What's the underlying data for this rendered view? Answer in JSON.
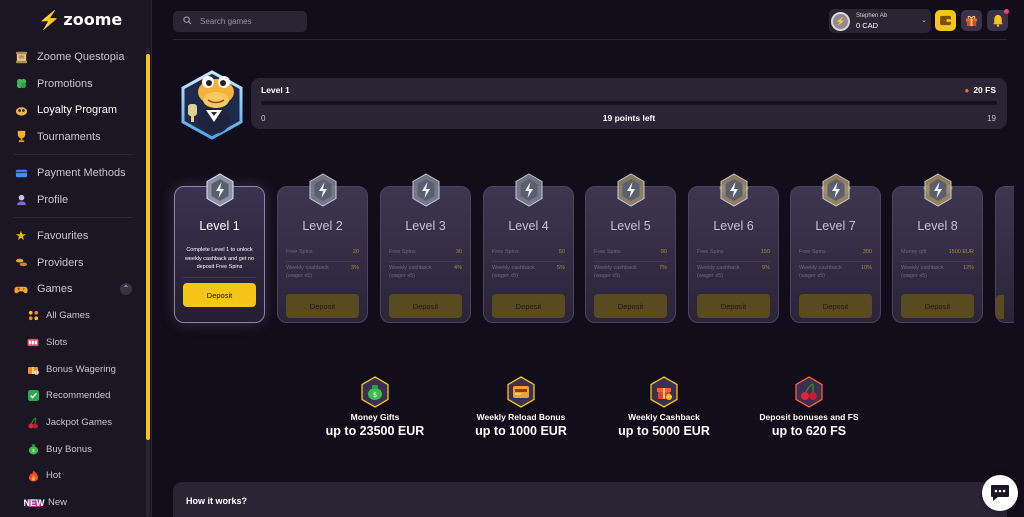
{
  "brand": {
    "name": "zoome"
  },
  "sidebar": {
    "items": [
      {
        "label": "Zoome Questopia",
        "icon": "scroll-icon"
      },
      {
        "label": "Promotions",
        "icon": "clover-icon"
      },
      {
        "label": "Loyalty Program",
        "icon": "loyalty-icon",
        "active": true
      },
      {
        "label": "Tournaments",
        "icon": "trophy-icon"
      },
      {
        "label": "Payment Methods",
        "icon": "card-icon"
      },
      {
        "label": "Profile",
        "icon": "profile-icon"
      },
      {
        "label": "Favourites",
        "icon": "star-icon"
      },
      {
        "label": "Providers",
        "icon": "providers-icon"
      },
      {
        "label": "Games",
        "icon": "gamepad-icon"
      }
    ],
    "games_sub": [
      {
        "label": "All Games",
        "icon": "grid-icon"
      },
      {
        "label": "Slots",
        "icon": "slots-icon"
      },
      {
        "label": "Bonus Wagering",
        "icon": "bonus-icon"
      },
      {
        "label": "Recommended",
        "icon": "check-icon"
      },
      {
        "label": "Jackpot Games",
        "icon": "cherry-icon"
      },
      {
        "label": "Buy Bonus",
        "icon": "money-bag-icon"
      },
      {
        "label": "Hot",
        "icon": "fire-icon"
      },
      {
        "label": "New",
        "icon": "new-badge-icon",
        "badge": "NEW"
      }
    ]
  },
  "search": {
    "placeholder": "Search games"
  },
  "user": {
    "name": "Stephen Ab",
    "balance": "0 CAD"
  },
  "level_progress": {
    "title": "Level 1",
    "reward": "20 FS",
    "min": "0",
    "max": "19",
    "points_left": "19 points left",
    "progress": 0
  },
  "levels": [
    {
      "title": "Level 1",
      "active": true,
      "description": "Complete Level 1 to unlock weekly cashback and get no deposit Free Spins",
      "deposit": "Deposit"
    },
    {
      "title": "Level 2",
      "row1_k": "Free Spins",
      "row1_v": "20",
      "row2_k": "Weekly cashback (wager x5)",
      "row2_v": "3%",
      "deposit": "Deposit"
    },
    {
      "title": "Level 3",
      "row1_k": "Free Spins",
      "row1_v": "30",
      "row2_k": "Weekly cashback (wager x5)",
      "row2_v": "4%",
      "deposit": "Deposit"
    },
    {
      "title": "Level 4",
      "row1_k": "Free Spins",
      "row1_v": "50",
      "row2_k": "Weekly cashback (wager x5)",
      "row2_v": "5%",
      "deposit": "Deposit"
    },
    {
      "title": "Level 5",
      "row1_k": "Free Spins",
      "row1_v": "90",
      "row2_k": "Weekly cashback (wager x5)",
      "row2_v": "7%",
      "deposit": "Deposit"
    },
    {
      "title": "Level 6",
      "row1_k": "Free Spins",
      "row1_v": "150",
      "row2_k": "Weekly cashback (wager x5)",
      "row2_v": "9%",
      "deposit": "Deposit"
    },
    {
      "title": "Level 7",
      "row1_k": "Free Spins",
      "row1_v": "300",
      "row2_k": "Weekly cashback (wager x5)",
      "row2_v": "10%",
      "deposit": "Deposit"
    },
    {
      "title": "Level 8",
      "row1_k": "Money gift",
      "row1_v": "1500 EUR",
      "row2_k": "Weekly cashback (wager x5)",
      "row2_v": "12%",
      "deposit": "Deposit"
    }
  ],
  "benefits": [
    {
      "title": "Money Gifts",
      "value": "up to 23500 EUR",
      "icon": "money-bag-icon"
    },
    {
      "title": "Weekly Reload Bonus",
      "value": "up to 1000 EUR",
      "icon": "wallet-icon"
    },
    {
      "title": "Weekly Cashback",
      "value": "up to 5000 EUR",
      "icon": "gift-icon"
    },
    {
      "title": "Deposit bonuses and FS",
      "value": "up to 620 FS",
      "icon": "cherry-icon"
    }
  ],
  "how_it_works": {
    "title": "How it works?"
  },
  "colors": {
    "accent": "#f5c518",
    "background": "#120d1a",
    "card": "#2a2434"
  }
}
